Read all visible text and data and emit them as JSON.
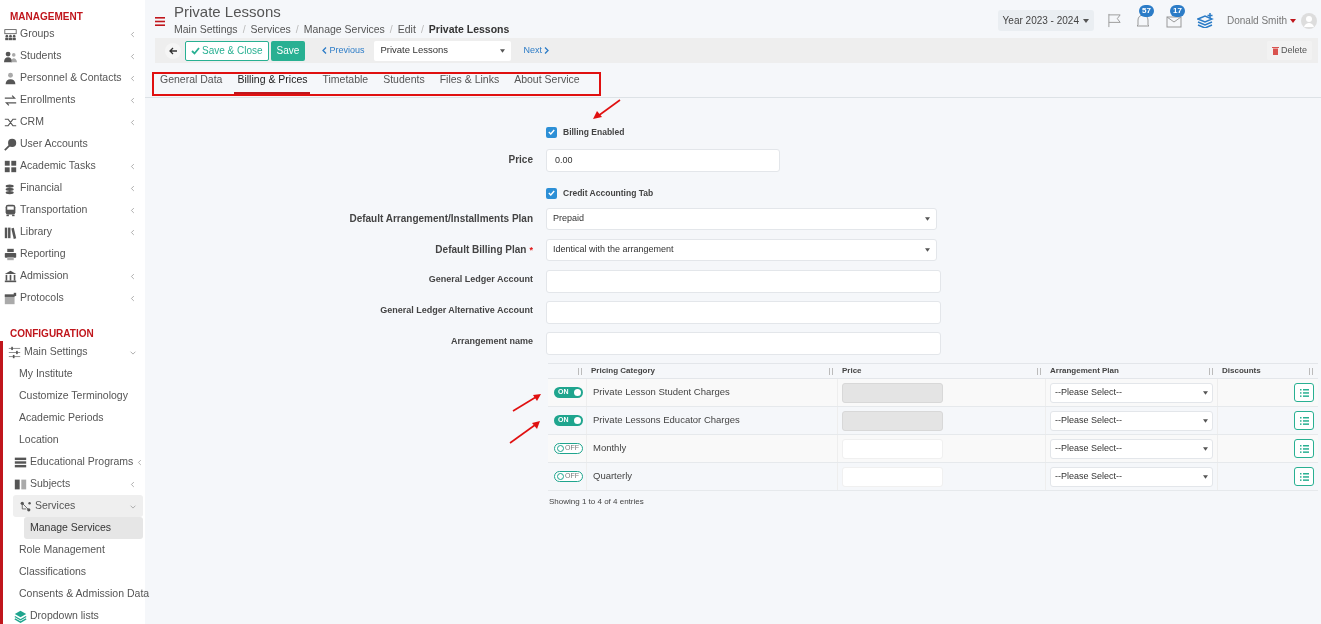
{
  "sidebar": {
    "sections": [
      {
        "title": "MANAGEMENT",
        "items": [
          {
            "label": "Groups",
            "expanded": false,
            "selected": false
          },
          {
            "label": "Students",
            "expanded": false,
            "selected": false
          },
          {
            "label": "Personnel & Contacts",
            "expanded": false,
            "selected": false
          },
          {
            "label": "Enrollments",
            "expanded": false,
            "selected": false
          },
          {
            "label": "CRM",
            "expanded": false,
            "selected": false
          },
          {
            "label": "User Accounts",
            "selected": false
          },
          {
            "label": "Academic Tasks",
            "expanded": false,
            "selected": false
          },
          {
            "label": "Financial",
            "expanded": false,
            "selected": false
          },
          {
            "label": "Transportation",
            "expanded": false,
            "selected": false
          },
          {
            "label": "Library",
            "expanded": false,
            "selected": false
          },
          {
            "label": "Reporting",
            "selected": false
          },
          {
            "label": "Admission",
            "expanded": false,
            "selected": false
          },
          {
            "label": "Protocols",
            "expanded": false,
            "selected": false
          }
        ]
      },
      {
        "title": "CONFIGURATION",
        "items": [
          {
            "label": "Main Settings",
            "expanded": true,
            "selected": false,
            "children": [
              {
                "label": "My Institute",
                "selected": false
              },
              {
                "label": "Customize Terminology",
                "selected": false
              },
              {
                "label": "Academic Periods",
                "selected": false
              },
              {
                "label": "Location",
                "selected": false
              },
              {
                "label": "Educational Programs",
                "expanded": false,
                "selected": false
              },
              {
                "label": "Subjects",
                "expanded": false,
                "selected": false
              },
              {
                "label": "Services",
                "expanded": true,
                "selected": true,
                "children": [
                  {
                    "label": "Manage Services",
                    "selected": true
                  }
                ]
              },
              {
                "label": "Role Management",
                "selected": false
              },
              {
                "label": "Classifications",
                "selected": false
              },
              {
                "label": "Consents & Admission Data",
                "selected": false
              },
              {
                "label": "Dropdown lists",
                "selected": false
              }
            ]
          }
        ]
      }
    ]
  },
  "header": {
    "title": "Private Lessons",
    "separator": "/",
    "breadcrumbs": [
      {
        "label": "Main Settings",
        "current": false
      },
      {
        "label": "Services",
        "current": false
      },
      {
        "label": "Manage Services",
        "current": false
      },
      {
        "label": "Edit",
        "current": false
      },
      {
        "label": "Private Lessons",
        "current": true
      }
    ],
    "year": "Year 2023 - 2024",
    "notifications": "57",
    "messages": "17",
    "user": "Donald Smith"
  },
  "toolbar": {
    "save_close": "Save & Close",
    "save": "Save",
    "previous": "Previous",
    "record": "Private Lessons",
    "next": "Next",
    "delete": "Delete"
  },
  "tabs": [
    {
      "label": "General Data",
      "selected": false
    },
    {
      "label": "Billing & Prices",
      "selected": true
    },
    {
      "label": "Timetable",
      "selected": false
    },
    {
      "label": "Students",
      "selected": false
    },
    {
      "label": "Files & Links",
      "selected": false
    },
    {
      "label": "About Service",
      "selected": false
    }
  ],
  "form": [
    {
      "kind": "checkbox",
      "label": "Billing Enabled",
      "checked": true
    },
    {
      "kind": "number",
      "label": "Price",
      "value": "0.00"
    },
    {
      "kind": "checkbox",
      "label": "Credit Accounting Tab",
      "checked": true
    },
    {
      "kind": "select",
      "label": "Default Arrangement/Installments Plan",
      "value": "Prepaid"
    },
    {
      "kind": "select",
      "label": "Default Billing Plan",
      "value": "Identical with the arrangement",
      "required_mark": "*"
    },
    {
      "kind": "input",
      "label": "General Ledger Account"
    },
    {
      "kind": "input",
      "label": "General Ledger Alternative Account"
    },
    {
      "kind": "input",
      "label": "Arrangement name"
    }
  ],
  "table": {
    "columns": [
      "Pricing Category",
      "Price",
      "Arrangement Plan",
      "Discounts"
    ],
    "rows": [
      {
        "on": true,
        "toggle_label": "ON",
        "category": "Private Lesson Student Charges",
        "price_disabled": true,
        "plan": "--Please Select--"
      },
      {
        "on": true,
        "toggle_label": "ON",
        "category": "Private Lessons Educator Charges",
        "price_disabled": true,
        "plan": "--Please Select--"
      },
      {
        "on": false,
        "toggle_label": "OFF",
        "category": "Monthly",
        "price_disabled": false,
        "plan": "--Please Select--"
      },
      {
        "on": false,
        "toggle_label": "OFF",
        "category": "Quarterly",
        "price_disabled": false,
        "plan": "--Please Select--"
      }
    ],
    "footer": "Showing 1 to 4 of 4 entries"
  }
}
